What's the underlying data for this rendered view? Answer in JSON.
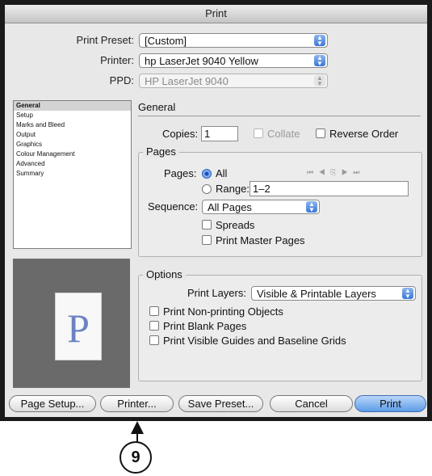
{
  "window": {
    "title": "Print"
  },
  "top": {
    "preset_label": "Print Preset:",
    "preset_value": "[Custom]",
    "printer_label": "Printer:",
    "printer_value": "hp LaserJet 9040 Yellow",
    "ppd_label": "PPD:",
    "ppd_value": "HP LaserJet 9040"
  },
  "sidebar": {
    "items": [
      "General",
      "Setup",
      "Marks and Bleed",
      "Output",
      "Graphics",
      "Colour Management",
      "Advanced",
      "Summary"
    ],
    "selected": "General"
  },
  "preview": {
    "letter": "P"
  },
  "general": {
    "section_title": "General",
    "copies_label": "Copies:",
    "copies_value": "1",
    "collate_label": "Collate",
    "reverse_label": "Reverse Order",
    "pages_group": "Pages",
    "pages_label": "Pages:",
    "all_label": "All",
    "range_label": "Range:",
    "range_value": "1–2",
    "nav_glyphs": "⏮ ◀ ⎘ ▶ ⏭",
    "sequence_label": "Sequence:",
    "sequence_value": "All Pages",
    "spreads_label": "Spreads",
    "master_label": "Print Master Pages"
  },
  "options": {
    "group": "Options",
    "layers_label": "Print Layers:",
    "layers_value": "Visible & Printable Layers",
    "nonprinting_label": "Print Non-printing Objects",
    "blank_label": "Print Blank Pages",
    "guides_label": "Print Visible Guides and Baseline Grids"
  },
  "buttons": {
    "page_setup": "Page Setup...",
    "printer": "Printer...",
    "save_preset": "Save Preset...",
    "cancel": "Cancel",
    "print": "Print"
  },
  "callout": {
    "number": "9"
  },
  "colors": {
    "accent": "#5d9ce8",
    "window_bg": "#e8e8e8",
    "frame": "#1a1a1a"
  }
}
